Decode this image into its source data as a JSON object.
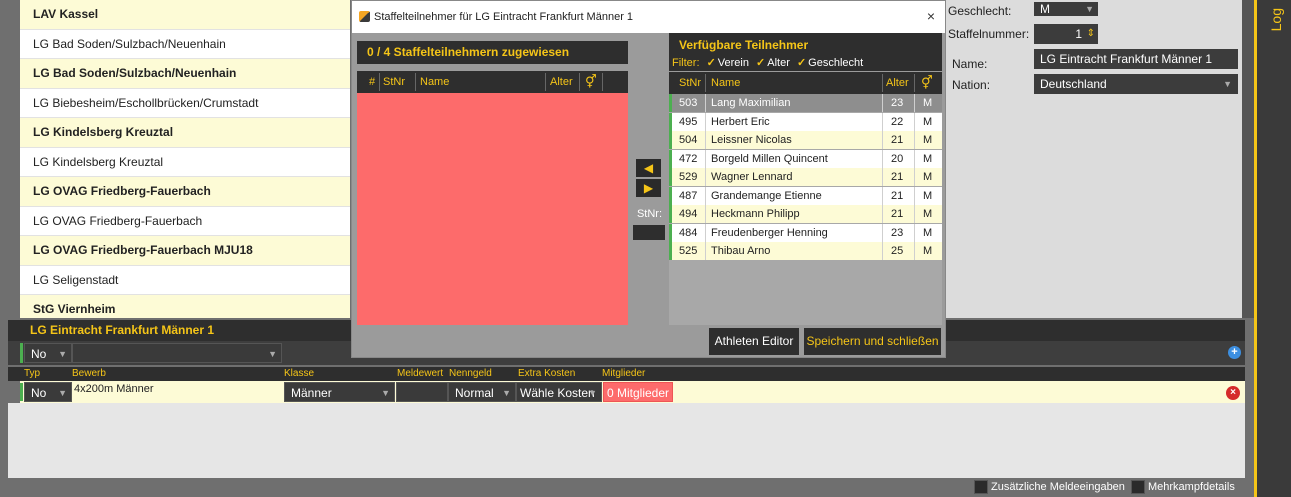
{
  "teams": [
    {
      "label": "LAV Kassel",
      "style": "hl"
    },
    {
      "label": "LG Bad Soden/Sulzbach/Neuenhain",
      "style": "wh"
    },
    {
      "label": "LG Bad Soden/Sulzbach/Neuenhain",
      "style": "hl"
    },
    {
      "label": "LG Biebesheim/Eschollbrücken/Crumstadt",
      "style": "wh"
    },
    {
      "label": "LG Kindelsberg Kreuztal",
      "style": "hl"
    },
    {
      "label": "LG Kindelsberg Kreuztal",
      "style": "wh"
    },
    {
      "label": "LG OVAG Friedberg-Fauerbach",
      "style": "hl"
    },
    {
      "label": "LG OVAG Friedberg-Fauerbach",
      "style": "wh"
    },
    {
      "label": "LG OVAG Friedberg-Fauerbach MJU18",
      "style": "hl"
    },
    {
      "label": "LG Seligenstadt",
      "style": "wh"
    },
    {
      "label": "StG Viernheim",
      "style": "hl"
    }
  ],
  "details": {
    "geschlecht_label": "Geschlecht:",
    "geschlecht_value": "M",
    "staffelnummer_label": "Staffelnummer:",
    "staffelnummer_value": "1",
    "name_label": "Name:",
    "name_value": "LG Eintracht Frankfurt Männer 1",
    "nation_label": "Nation:",
    "nation_value": "Deutschland"
  },
  "sidebar": {
    "log_label": "Log"
  },
  "bottom": {
    "team_header": "LG Eintracht Frankfurt Männer 1",
    "filter_type": "No",
    "columns": [
      "Typ",
      "Bewerb",
      "Klasse",
      "Meldewert",
      "Nenngeld",
      "Extra Kosten",
      "Mitglieder"
    ],
    "entry": {
      "typ": "No",
      "bewerb": "4x200m Männer",
      "klasse": "Männer",
      "meldewert": "",
      "nenngeld": "Normal",
      "extra_kosten": "Wähle Kosten",
      "mitglieder": "0 Mitglieder"
    },
    "footer": {
      "zusatz": "Zusätzliche Meldeeingaben",
      "mehrkampf": "Mehrkampfdetails"
    }
  },
  "modal": {
    "title": "Staffelteilnehmer für LG Eintracht Frankfurt Männer 1",
    "close_icon": "×",
    "left_header": "0 / 4 Staffelteilnehmern zugewiesen",
    "left_columns": {
      "hash": "#",
      "stnr": "StNr",
      "name": "Name",
      "alter": "Alter",
      "sex": "⚥"
    },
    "move_right_icon": "◀",
    "move_left_icon": "▶",
    "stnr_label": "StNr:",
    "right_header": "Verfügbare Teilnehmer",
    "filter_label": "Filter:",
    "filter_verein": "Verein",
    "filter_alter": "Alter",
    "filter_geschlecht": "Geschlecht",
    "check_glyph": "✓",
    "right_columns": {
      "stnr": "StNr",
      "name": "Name",
      "alter": "Alter",
      "sex": "⚥"
    },
    "participants": [
      {
        "stnr": "503",
        "name": "Lang Maximilian",
        "alter": "23",
        "sex": "M",
        "style": "sel"
      },
      {
        "stnr": "495",
        "name": "Herbert Eric",
        "alter": "22",
        "sex": "M",
        "style": "wht"
      },
      {
        "stnr": "504",
        "name": "Leissner Nicolas",
        "alter": "21",
        "sex": "M",
        "style": "yel"
      },
      {
        "stnr": "472",
        "name": "Borgeld Millen Quincent",
        "alter": "20",
        "sex": "M",
        "style": "wht"
      },
      {
        "stnr": "529",
        "name": "Wagner Lennard",
        "alter": "21",
        "sex": "M",
        "style": "yel"
      },
      {
        "stnr": "487",
        "name": "Grandemange Etienne",
        "alter": "21",
        "sex": "M",
        "style": "wht"
      },
      {
        "stnr": "494",
        "name": "Heckmann Philipp",
        "alter": "21",
        "sex": "M",
        "style": "yel"
      },
      {
        "stnr": "484",
        "name": "Freudenberger Henning",
        "alter": "23",
        "sex": "M",
        "style": "wht"
      },
      {
        "stnr": "525",
        "name": "Thibau Arno",
        "alter": "25",
        "sex": "M",
        "style": "yel"
      }
    ],
    "btn_athleten": "Athleten Editor",
    "btn_save": "Speichern und schließen"
  }
}
